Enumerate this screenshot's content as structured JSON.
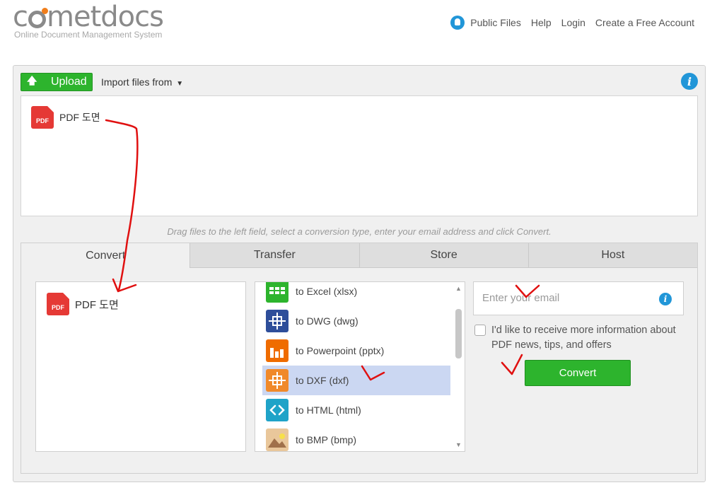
{
  "brand": {
    "logo_text_pre": "c",
    "logo_text_post": "metdocs",
    "tagline": "Online Document Management System"
  },
  "nav": {
    "public_files": "Public Files",
    "help": "Help",
    "login": "Login",
    "create_account": "Create a Free Account"
  },
  "toolbar": {
    "upload_label": "Upload",
    "import_label": "Import files from"
  },
  "dropzone": {
    "files": [
      {
        "name": "PDF 도면",
        "icon_label": "PDF"
      }
    ]
  },
  "hint": "Drag files to the left field, select a conversion type, enter your email address and click Convert.",
  "tabs": [
    {
      "label": "Convert",
      "active": true
    },
    {
      "label": "Transfer",
      "active": false
    },
    {
      "label": "Store",
      "active": false
    },
    {
      "label": "Host",
      "active": false
    }
  ],
  "selected_files": [
    {
      "name": "PDF 도면",
      "icon_label": "PDF"
    }
  ],
  "formats": [
    {
      "label": "to Excel (xlsx)",
      "icon": "excel-icon",
      "color": "#2db42d",
      "selected": false
    },
    {
      "label": "to DWG (dwg)",
      "icon": "dwg-icon",
      "color": "#2e4e9a",
      "selected": false
    },
    {
      "label": "to Powerpoint (pptx)",
      "icon": "powerpoint-icon",
      "color": "#ef6c00",
      "selected": false
    },
    {
      "label": "to DXF (dxf)",
      "icon": "dxf-icon",
      "color": "#f0892a",
      "selected": true
    },
    {
      "label": "to HTML (html)",
      "icon": "html-icon",
      "color": "#1fa3c8",
      "selected": false
    },
    {
      "label": "to BMP (bmp)",
      "icon": "bmp-icon",
      "color": "#d9a86a",
      "selected": false
    }
  ],
  "email": {
    "placeholder": "Enter your email",
    "value": ""
  },
  "optin_label": "I'd like to receive more information about PDF news, tips, and offers",
  "convert_label": "Convert",
  "colors": {
    "accent_green": "#2db42d",
    "info_blue": "#2196d8",
    "selection": "#cbd7f2",
    "annotation_red": "#e01010"
  }
}
